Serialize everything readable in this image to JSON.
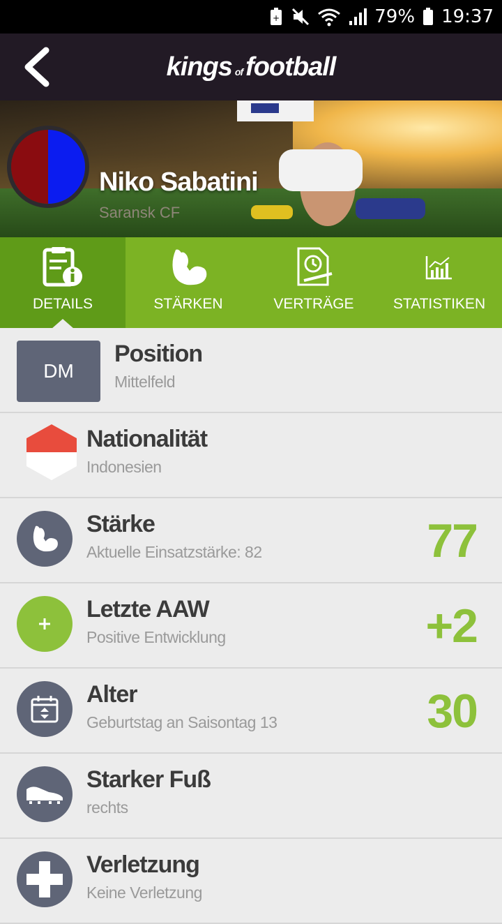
{
  "status_bar": {
    "battery_percent": "79%",
    "time": "19:37"
  },
  "app_bar": {
    "logo_part1": "kings",
    "logo_part2": "of",
    "logo_part3": "football"
  },
  "player": {
    "name": "Niko Sabatini",
    "club": "Saransk CF"
  },
  "tabs": [
    {
      "label": "DETAILS",
      "icon": "document-info-icon",
      "active": true
    },
    {
      "label": "STÄRKEN",
      "icon": "bicep-icon"
    },
    {
      "label": "VERTRÄGE",
      "icon": "contract-clock-icon"
    },
    {
      "label": "STATISTIKEN",
      "icon": "bar-chart-icon"
    }
  ],
  "rows": {
    "position": {
      "code": "DM",
      "title": "Position",
      "sub": "Mittelfeld"
    },
    "nationality": {
      "title": "Nationalität",
      "sub": "Indonesien",
      "flag_top": "#e84c3d",
      "flag_bottom": "#ffffff"
    },
    "strength": {
      "title": "Stärke",
      "sub": "Aktuelle Einsatzstärke: 82",
      "value": "77"
    },
    "last_aaw": {
      "title": "Letzte AAW",
      "sub": "Positive Entwicklung",
      "value": "+2"
    },
    "age": {
      "title": "Alter",
      "sub": "Geburtstag an Saisontag 13",
      "value": "30"
    },
    "foot": {
      "title": "Starker Fuß",
      "sub": "rechts"
    },
    "injury": {
      "title": "Verletzung",
      "sub": "Keine Verletzung"
    }
  },
  "colors": {
    "accent_green": "#8dc13b",
    "tab_bar": "#7cb324",
    "tab_active": "#5f9b18",
    "icon_grey": "#5f6577",
    "header": "#221a25"
  }
}
